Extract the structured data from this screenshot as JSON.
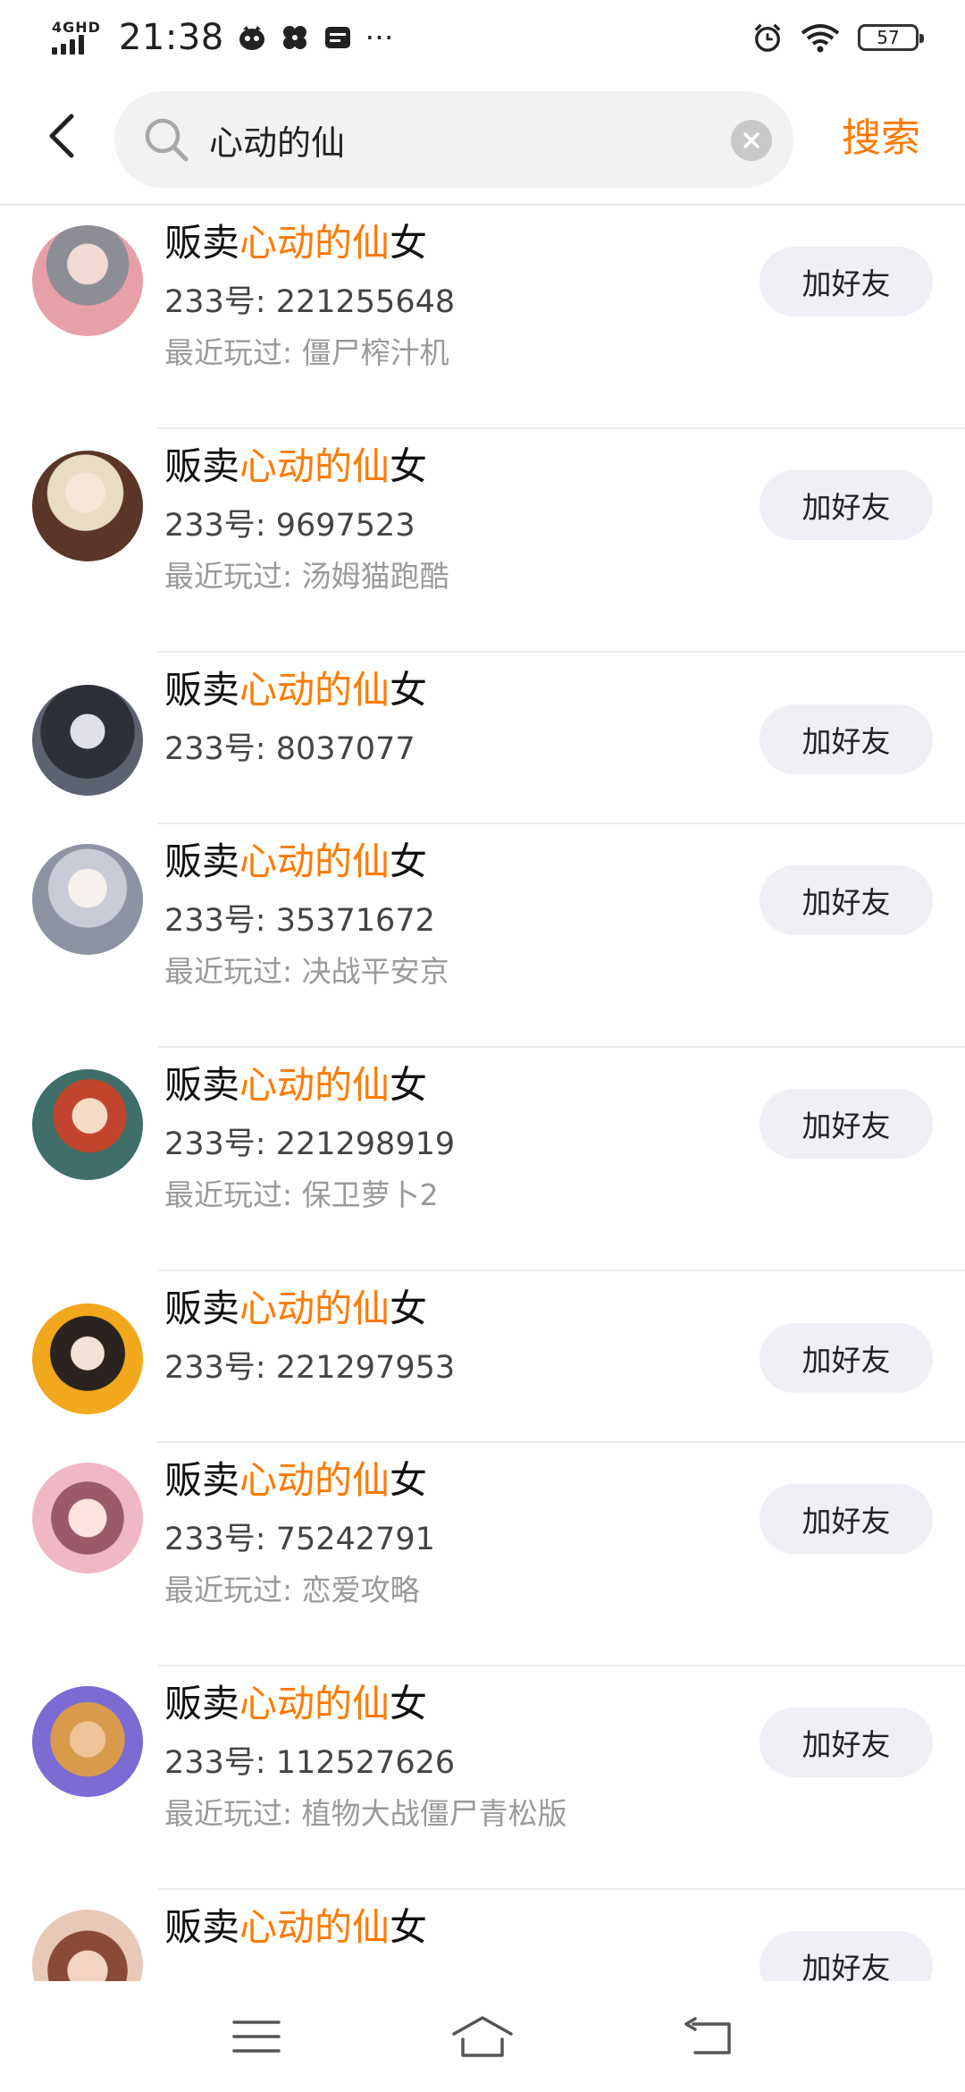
{
  "status_bar": {
    "network": "4GHD",
    "time": "21:38",
    "overflow": "···",
    "battery": "57",
    "icons": [
      "signal-icon",
      "app-notification-icon",
      "fan-app-icon",
      "wallet-icon",
      "alarm-icon",
      "wifi-icon",
      "battery-icon"
    ]
  },
  "header": {
    "back_icon": "chevron-left-icon",
    "search_value": "心动的仙",
    "search_icon": "search-icon",
    "clear_icon": "clear-icon",
    "search_label": "搜索"
  },
  "colors": {
    "accent": "#ff7a00",
    "button_bg": "#eef0f6",
    "secondary_text": "#9a9a9a"
  },
  "results": [
    {
      "name_prefix": "贩卖",
      "name_highlight": "心动的仙",
      "name_suffix": "女",
      "uid": "233号: 221255648",
      "recent": "最近玩过: 僵尸榨汁机",
      "button": "加好友"
    },
    {
      "name_prefix": "贩卖",
      "name_highlight": "心动的仙",
      "name_suffix": "女",
      "uid": "233号: 9697523",
      "recent": "最近玩过: 汤姆猫跑酷",
      "button": "加好友"
    },
    {
      "name_prefix": "贩卖",
      "name_highlight": "心动的仙",
      "name_suffix": "女",
      "uid": "233号: 8037077",
      "recent": "",
      "button": "加好友"
    },
    {
      "name_prefix": "贩卖",
      "name_highlight": "心动的仙",
      "name_suffix": "女",
      "uid": "233号: 35371672",
      "recent": "最近玩过: 决战平安京",
      "button": "加好友"
    },
    {
      "name_prefix": "贩卖",
      "name_highlight": "心动的仙",
      "name_suffix": "女",
      "uid": "233号: 221298919",
      "recent": "最近玩过: 保卫萝卜2",
      "button": "加好友"
    },
    {
      "name_prefix": "贩卖",
      "name_highlight": "心动的仙",
      "name_suffix": "女",
      "uid": "233号: 221297953",
      "recent": "",
      "button": "加好友"
    },
    {
      "name_prefix": "贩卖",
      "name_highlight": "心动的仙",
      "name_suffix": "女",
      "uid": "233号: 75242791",
      "recent": "最近玩过: 恋爱攻略",
      "button": "加好友"
    },
    {
      "name_prefix": "贩卖",
      "name_highlight": "心动的仙",
      "name_suffix": "女",
      "uid": "233号: 112527626",
      "recent": "最近玩过: 植物大战僵尸青松版",
      "button": "加好友"
    },
    {
      "name_prefix": "贩卖",
      "name_highlight": "心动的仙",
      "name_suffix": "女",
      "uid": "",
      "recent": "",
      "button": "加好友"
    }
  ],
  "nav_bar": {
    "icons": [
      "menu-icon",
      "home-icon",
      "back-icon"
    ]
  }
}
